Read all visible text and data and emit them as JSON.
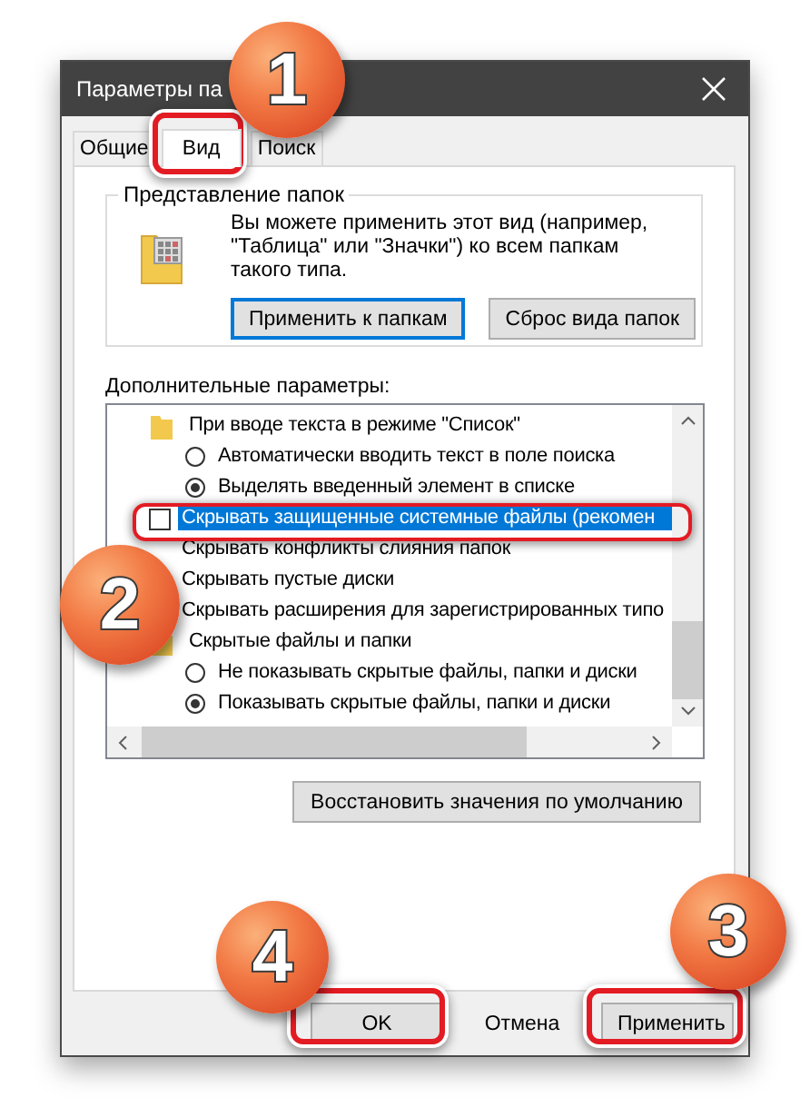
{
  "window": {
    "title": "Параметры па"
  },
  "tabs": [
    {
      "label": "Общие",
      "selected": false
    },
    {
      "label": "Вид",
      "selected": true
    },
    {
      "label": "Поиск",
      "selected": false
    }
  ],
  "folder_views": {
    "title": "Представление папок",
    "description": "Вы можете применить этот вид (например, \"Таблица\" или \"Значки\") ко всем папкам такого типа.",
    "buttons": [
      {
        "label": "Применить к папкам",
        "focused": true
      },
      {
        "label": "Сброс вида папок",
        "focused": false
      }
    ]
  },
  "advanced": {
    "title": "Дополнительные параметры:",
    "items": [
      {
        "kind": "folder",
        "label": "При вводе текста в режиме \"Список\""
      },
      {
        "kind": "radio",
        "label": "Автоматически вводить текст в поле поиска",
        "checked": false
      },
      {
        "kind": "radio",
        "label": "Выделять введенный элемент в списке",
        "checked": true
      },
      {
        "kind": "checkbox",
        "label": "Скрывать защищенные системные файлы (рекомен",
        "checked": false,
        "selected": true
      },
      {
        "kind": "checkbox",
        "label": "Скрывать конфликты слияния папок",
        "selected": false
      },
      {
        "kind": "checkbox",
        "label": "Скрывать пустые диски",
        "selected": false
      },
      {
        "kind": "checkbox",
        "label": "Скрывать расширения для зарегистрированных типо",
        "selected": false
      },
      {
        "kind": "folder",
        "label": "Скрытые файлы и папки"
      },
      {
        "kind": "radio",
        "label": "Не показывать скрытые файлы, папки и диски",
        "checked": false
      },
      {
        "kind": "radio",
        "label": "Показывать скрытые файлы, папки и диски",
        "checked": true
      }
    ]
  },
  "restore_button": "Восстановить значения по умолчанию",
  "buttons": [
    "OK",
    "Отмена",
    "Применить"
  ],
  "callouts": [
    {
      "label": "1"
    },
    {
      "label": "2"
    },
    {
      "label": "4"
    },
    {
      "label": "3"
    }
  ]
}
